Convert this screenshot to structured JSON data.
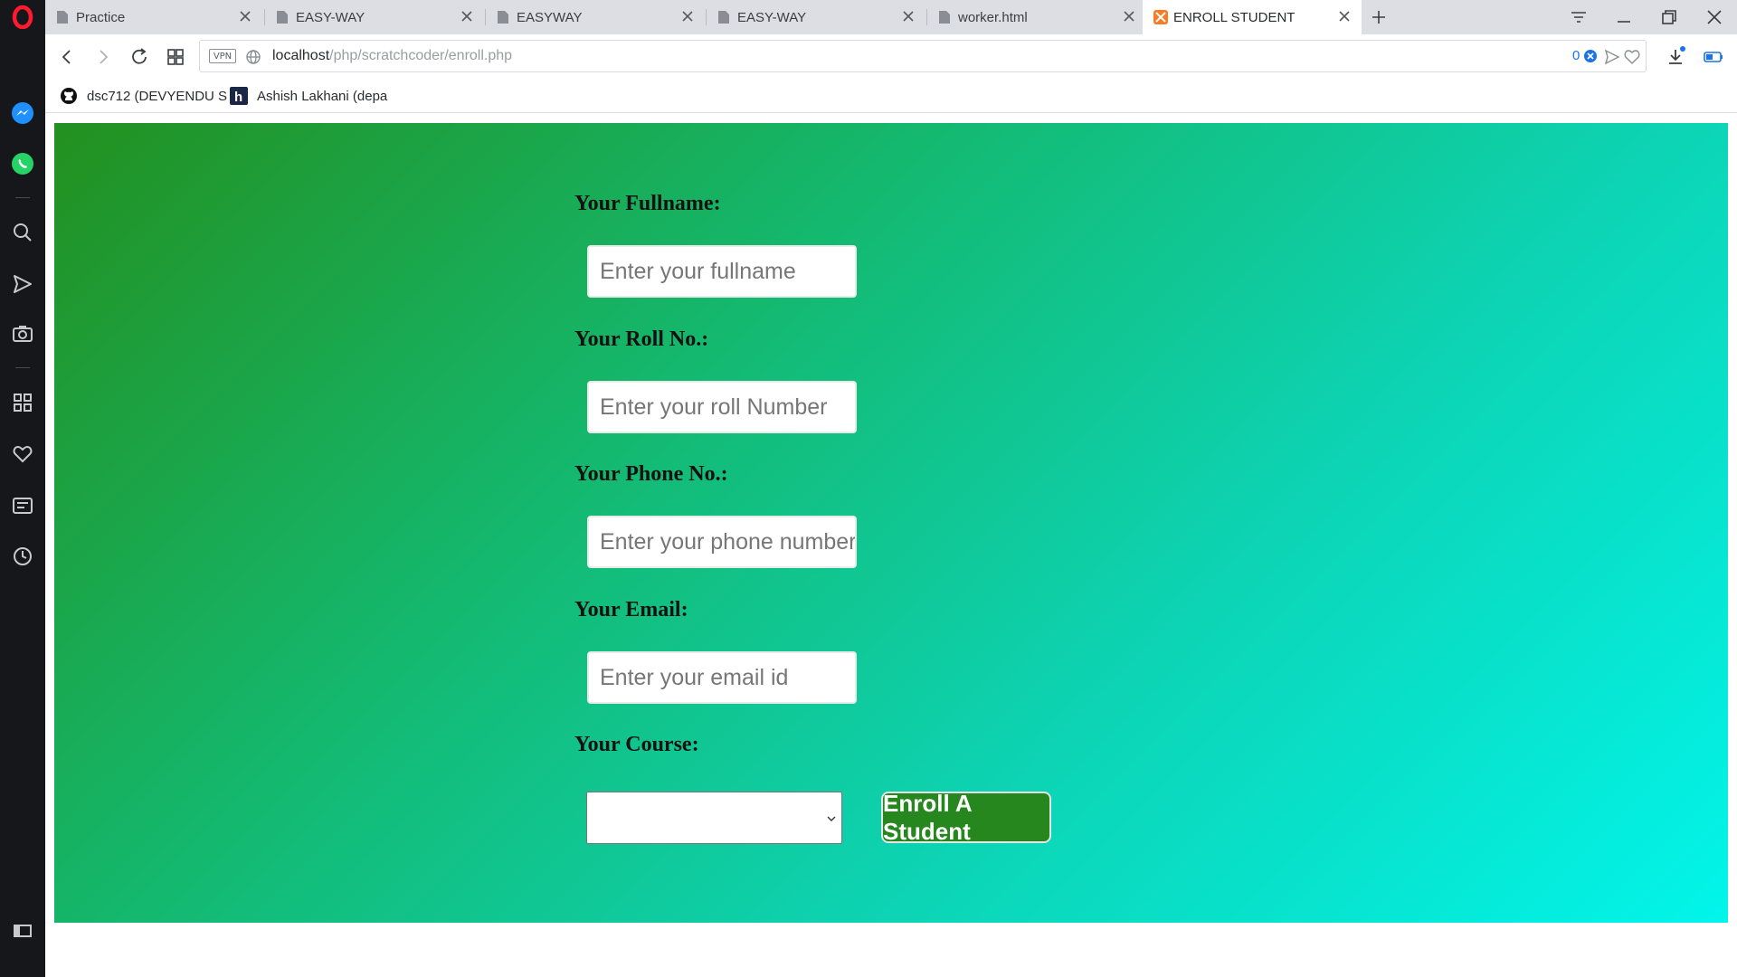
{
  "browser": {
    "tabs": [
      {
        "title": "Practice",
        "active": false
      },
      {
        "title": "EASY-WAY",
        "active": false
      },
      {
        "title": "EASYWAY",
        "active": false
      },
      {
        "title": "EASY-WAY",
        "active": false
      },
      {
        "title": "worker.html",
        "active": false
      },
      {
        "title": "ENROLL STUDENT",
        "active": true
      }
    ],
    "address": {
      "vpn_label": "VPN",
      "host": "localhost",
      "path": "/php/scratchcoder/enroll.php",
      "badge_count": "0"
    },
    "bookmarks": [
      {
        "label": "dsc712 (DEVYENDU S",
        "icon": "github-icon"
      },
      {
        "label": "Ashish Lakhani (depa",
        "icon": "hashnode-icon"
      }
    ]
  },
  "form": {
    "fullname_label": "Your Fullname:",
    "fullname_placeholder": "Enter your fullname",
    "roll_label": "Your Roll No.:",
    "roll_placeholder": "Enter your roll Number",
    "phone_label": "Your Phone No.:",
    "phone_placeholder": "Enter your phone number",
    "email_label": "Your Email:",
    "email_placeholder": "Enter your email id",
    "course_label": "Your Course:",
    "course_selected": "",
    "submit_label": "Enroll A Student"
  },
  "colors": {
    "gradient_start": "#23901f",
    "gradient_end": "#02f5eb",
    "button_bg": "#27871f",
    "sidebar_bg": "#16171b"
  }
}
